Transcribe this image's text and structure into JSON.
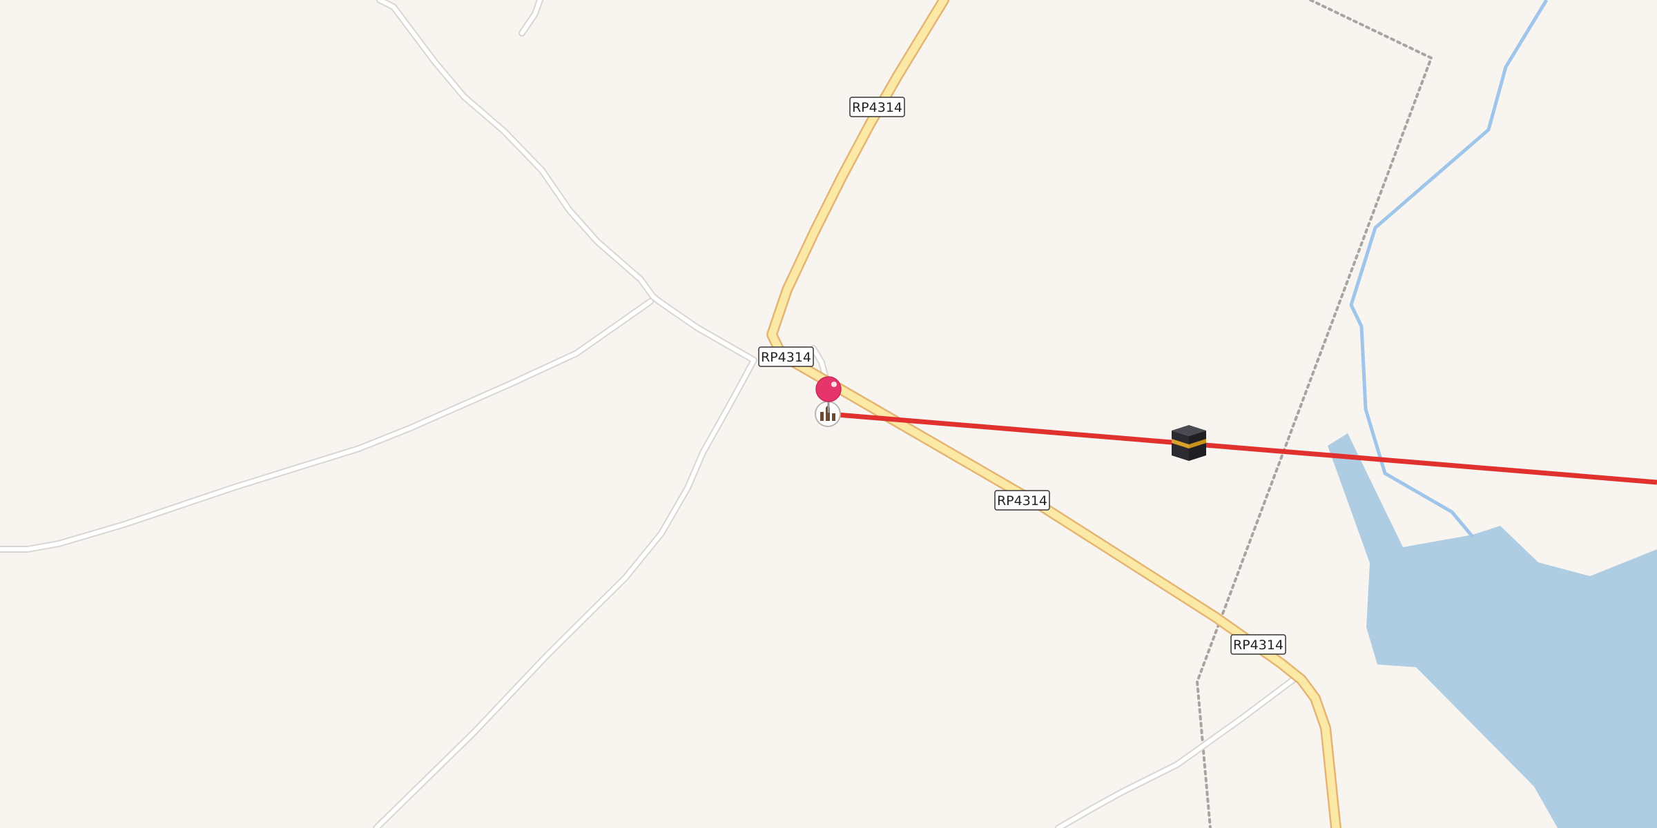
{
  "map": {
    "colors": {
      "land": "#f8f5f1",
      "minor_road_casing": "#dcdcdc",
      "minor_road": "#ffffff",
      "primary_road_casing": "#e4b572",
      "primary_road": "#fde9a6",
      "water": "#aecde3",
      "river": "#9fc6ea",
      "boundary": "#aaa3a0",
      "qibla_line": "#e0312e",
      "pin": "#e6356b"
    },
    "road_labels": [
      "RP4314",
      "RP4314",
      "RP4314",
      "RP4314"
    ],
    "icons": {
      "location_pin": "location-pin-icon",
      "mosque": "mosque-icon",
      "kaaba": "kaaba-icon"
    }
  }
}
